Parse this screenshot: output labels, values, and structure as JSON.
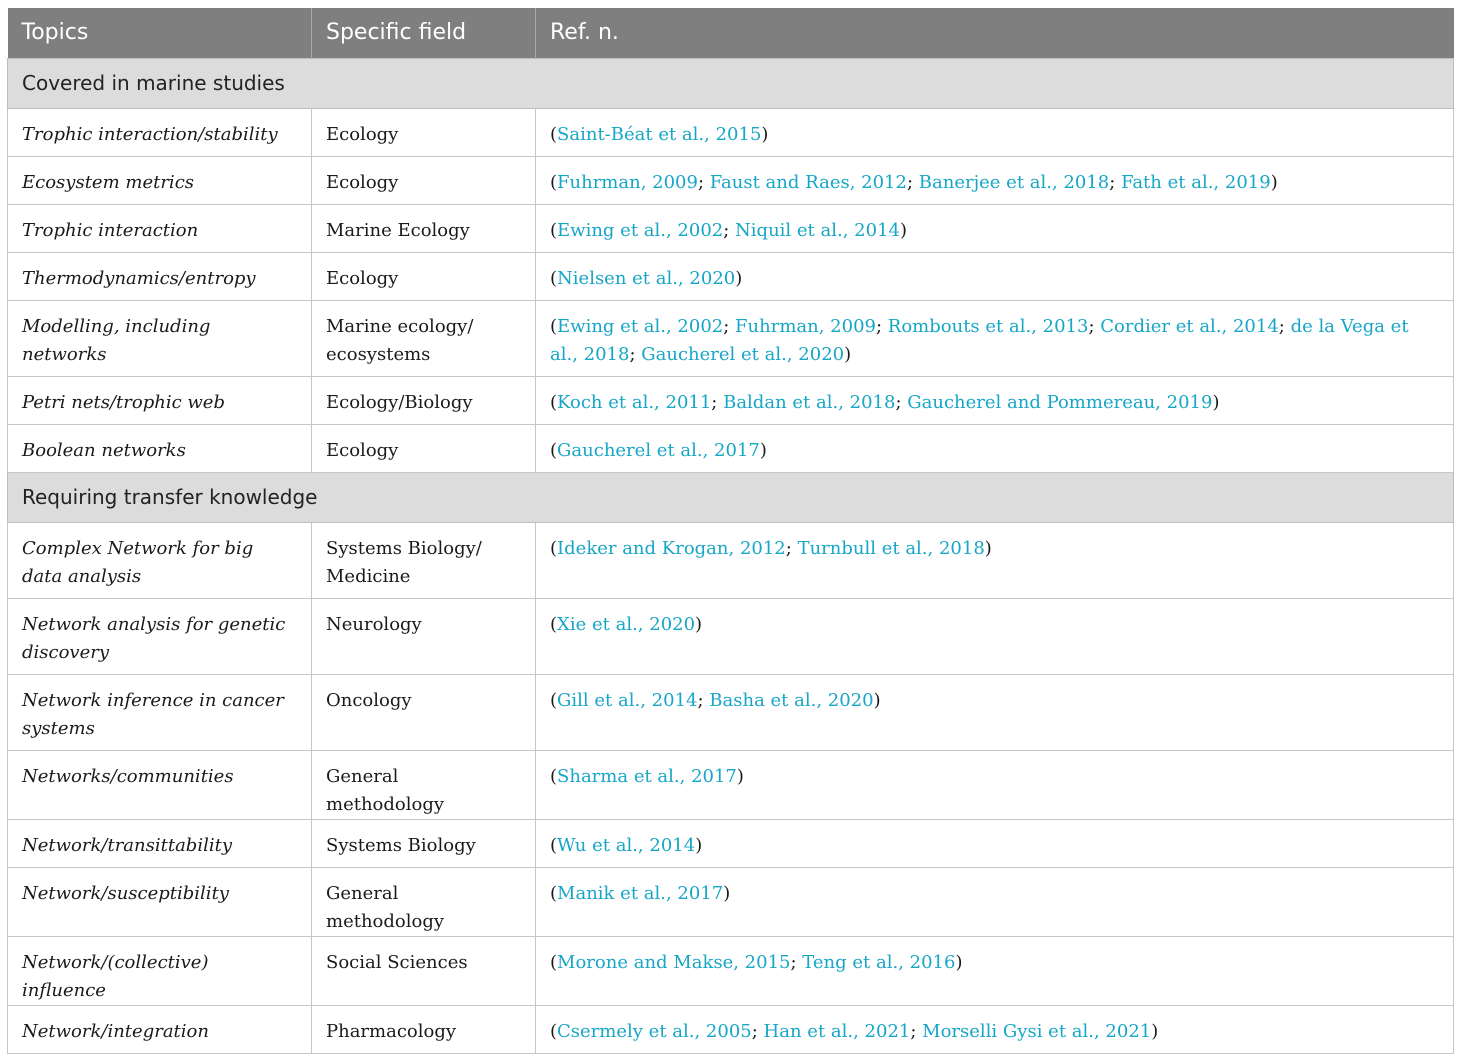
{
  "table": {
    "headers": [
      "Topics",
      "Specific field",
      "Ref. n."
    ],
    "sections": [
      {
        "title": "Covered in marine studies",
        "rows": [
          {
            "topic": "Trophic interaction/stability",
            "field": "Ecology",
            "refs": [
              "Saint-Béat et al., 2015"
            ],
            "height": 48
          },
          {
            "topic": "Ecosystem metrics",
            "field": "Ecology",
            "refs": [
              "Fuhrman, 2009",
              "Faust and Raes, 2012",
              "Banerjee et al., 2018",
              "Fath et al., 2019"
            ],
            "height": 48
          },
          {
            "topic": "Trophic interaction",
            "field": "Marine Ecology",
            "refs": [
              "Ewing et al., 2002",
              "Niquil et al., 2014"
            ],
            "height": 48
          },
          {
            "topic": "Thermodynamics/entropy",
            "field": "Ecology",
            "refs": [
              "Nielsen et al., 2020"
            ],
            "height": 48
          },
          {
            "topic": "Modelling, including networks",
            "field": "Marine ecology/ ecosystems",
            "refs": [
              "Ewing et al., 2002",
              "Fuhrman, 2009",
              "Rombouts et al., 2013",
              "Cordier et al., 2014",
              "de la Vega et al., 2018",
              "Gaucherel et al., 2020"
            ],
            "height": 76
          },
          {
            "topic": "Petri nets/trophic web",
            "field": "Ecology/Biology",
            "refs": [
              "Koch et al., 2011",
              "Baldan et al., 2018",
              "Gaucherel and Pommereau, 2019"
            ],
            "height": 48
          },
          {
            "topic": "Boolean networks",
            "field": "Ecology",
            "refs": [
              "Gaucherel et al., 2017"
            ],
            "height": 48
          }
        ]
      },
      {
        "title": "Requiring transfer knowledge",
        "rows": [
          {
            "topic": "Complex Network for big data analysis",
            "field": "Systems Biology/ Medicine",
            "refs": [
              "Ideker and Krogan, 2012",
              "Turnbull et al., 2018"
            ],
            "height": 76
          },
          {
            "topic": "Network analysis for genetic discovery",
            "field": "Neurology",
            "refs": [
              "Xie et al., 2020"
            ],
            "height": 76
          },
          {
            "topic": "Network inference in cancer systems",
            "field": "Oncology",
            "refs": [
              "Gill et al., 2014",
              "Basha et al., 2020"
            ],
            "height": 76
          },
          {
            "topic": "Networks/communities",
            "field": "General methodology",
            "refs": [
              "Sharma et al., 2017"
            ],
            "height": 48
          },
          {
            "topic": "Network/transittability",
            "field": "Systems Biology",
            "refs": [
              "Wu et al., 2014"
            ],
            "height": 48
          },
          {
            "topic": "Network/susceptibility",
            "field": "General methodology",
            "refs": [
              "Manik et al., 2017"
            ],
            "height": 48
          },
          {
            "topic": "Network/(collective) influence",
            "field": "Social Sciences",
            "refs": [
              "Morone and Makse, 2015",
              "Teng et al., 2016"
            ],
            "height": 48
          },
          {
            "topic": "Network/integration",
            "field": "Pharmacology",
            "refs": [
              "Csermely et al., 2005",
              "Han et al., 2021",
              "Morselli Gysi et al., 2021"
            ],
            "height": 48
          }
        ]
      }
    ]
  },
  "colors": {
    "header_bg": "#7f7f7f",
    "section_bg": "#dcdcdc",
    "link": "#16a6c6"
  }
}
